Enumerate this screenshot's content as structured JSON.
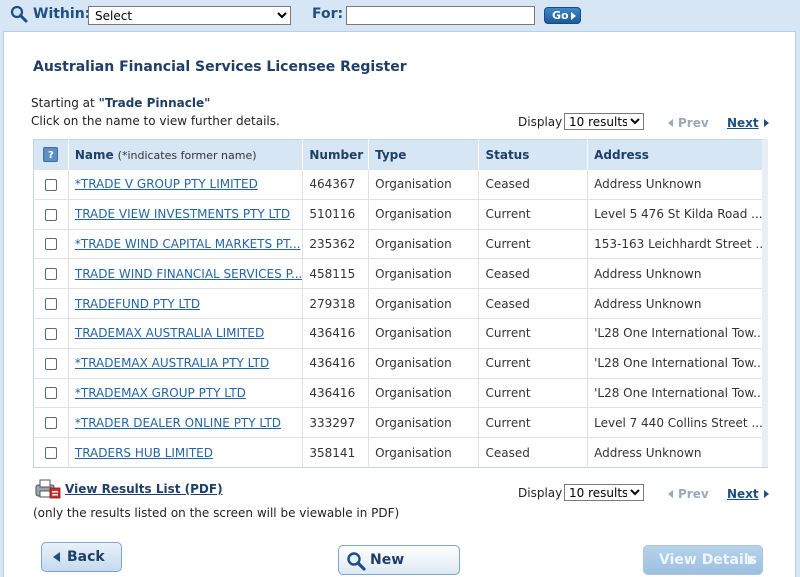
{
  "search": {
    "within_label": "Within:",
    "within_value": "Select",
    "for_label": "For:",
    "for_value": "",
    "go_label": "Go"
  },
  "page": {
    "title": "Australian Financial Services Licensee Register",
    "starting_prefix": "Starting at",
    "starting_value": "\"Trade Pinnacle\"",
    "instruction": "Click on the name to view further details."
  },
  "pager": {
    "display_label": "Display",
    "display_value": "10 results",
    "prev_label": "Prev",
    "next_label": "Next"
  },
  "table": {
    "help_icon": "?",
    "headers": {
      "name": "Name",
      "name_sub": "(*indicates former name)",
      "number": "Number",
      "type": "Type",
      "status": "Status",
      "address": "Address"
    },
    "rows": [
      {
        "name": "*TRADE V GROUP PTY LIMITED",
        "number": "464367",
        "type": "Organisation",
        "status": "Ceased",
        "address": "Address Unknown"
      },
      {
        "name": "TRADE VIEW INVESTMENTS PTY LTD",
        "number": "510116",
        "type": "Organisation",
        "status": "Current",
        "address": "Level 5 476 St Kilda Road ..."
      },
      {
        "name": "*TRADE WIND CAPITAL MARKETS PT...",
        "number": "235362",
        "type": "Organisation",
        "status": "Current",
        "address": "153-163 Leichhardt Street ..."
      },
      {
        "name": "TRADE WIND FINANCIAL SERVICES P...",
        "number": "458115",
        "type": "Organisation",
        "status": "Ceased",
        "address": "Address Unknown"
      },
      {
        "name": "TRADEFUND PTY LTD",
        "number": "279318",
        "type": "Organisation",
        "status": "Ceased",
        "address": "Address Unknown"
      },
      {
        "name": "TRADEMAX AUSTRALIA LIMITED",
        "number": "436416",
        "type": "Organisation",
        "status": "Current",
        "address": "'L28 One International Tow..."
      },
      {
        "name": "*TRADEMAX AUSTRALIA PTY LTD",
        "number": "436416",
        "type": "Organisation",
        "status": "Current",
        "address": "'L28 One International Tow..."
      },
      {
        "name": "*TRADEMAX GROUP PTY LTD",
        "number": "436416",
        "type": "Organisation",
        "status": "Current",
        "address": "'L28 One International Tow..."
      },
      {
        "name": "*TRADER DEALER ONLINE PTY LTD",
        "number": "333297",
        "type": "Organisation",
        "status": "Current",
        "address": "Level 7 440 Collins Street ..."
      },
      {
        "name": "TRADERS HUB LIMITED",
        "number": "358141",
        "type": "Organisation",
        "status": "Ceased",
        "address": "Address Unknown"
      }
    ]
  },
  "pdf": {
    "link_label": "View Results List (PDF)",
    "note": "(only the results listed on the screen will be viewable in PDF)"
  },
  "buttons": {
    "back": "Back",
    "new_search": "New Search",
    "view_details": "View Details"
  },
  "colors": {
    "accent": "#1f4f82",
    "link": "#2465a5",
    "header_bg": "#d6e6f4"
  }
}
